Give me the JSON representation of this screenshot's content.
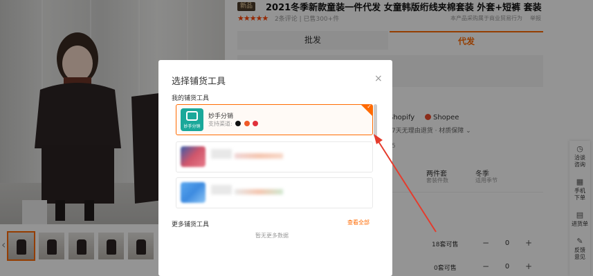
{
  "product": {
    "badge": "新品",
    "title": "2021冬季新款童装一件代发 女童韩版绗线夹棉套装 外套+短裤 套装",
    "stars": "★★★★★",
    "rating_text": "2条评论 | 已售300+件",
    "note": "本产品采购属于商业贸易行为",
    "report": "举报"
  },
  "tabs": {
    "wholesale": "批发",
    "dropship": "代发"
  },
  "background": {
    "platforms": [
      "Shopify",
      "Shopee"
    ],
    "policy": "7天无理由退货 · 材质保障 ⌄",
    "number": "5",
    "spec1_value": "两件套",
    "spec1_label": "套装件数",
    "spec2_value": "冬季",
    "spec2_label": "适用季节",
    "row1_stock": "18套可售",
    "row2_stock": "0套可售",
    "row1_qty": "0",
    "row2_qty": "0"
  },
  "sidebar": [
    {
      "icon": "clock-icon",
      "glyph": "◷",
      "label": "洽谈\n咨询"
    },
    {
      "icon": "qrcode-icon",
      "glyph": "▦",
      "label": "手机\n下单"
    },
    {
      "icon": "clipboard-icon",
      "glyph": "▤",
      "label": "进货单"
    },
    {
      "icon": "edit-icon",
      "glyph": "✎",
      "label": "反馈\n意见"
    }
  ],
  "modal": {
    "title": "选择铺货工具",
    "close": "×",
    "my_tools_label": "我的铺货工具",
    "tools": [
      {
        "name": "妙手分销",
        "subtitle": "支持渠道:",
        "logo_label": "妙手分销",
        "selected": true
      }
    ],
    "more_tools_label": "更多铺货工具",
    "view_all": "查看全部",
    "empty_text": "暂无更多数据"
  },
  "colors": {
    "accent": "#ff6a00",
    "overlay": "rgba(0,0,0,0.42)"
  }
}
